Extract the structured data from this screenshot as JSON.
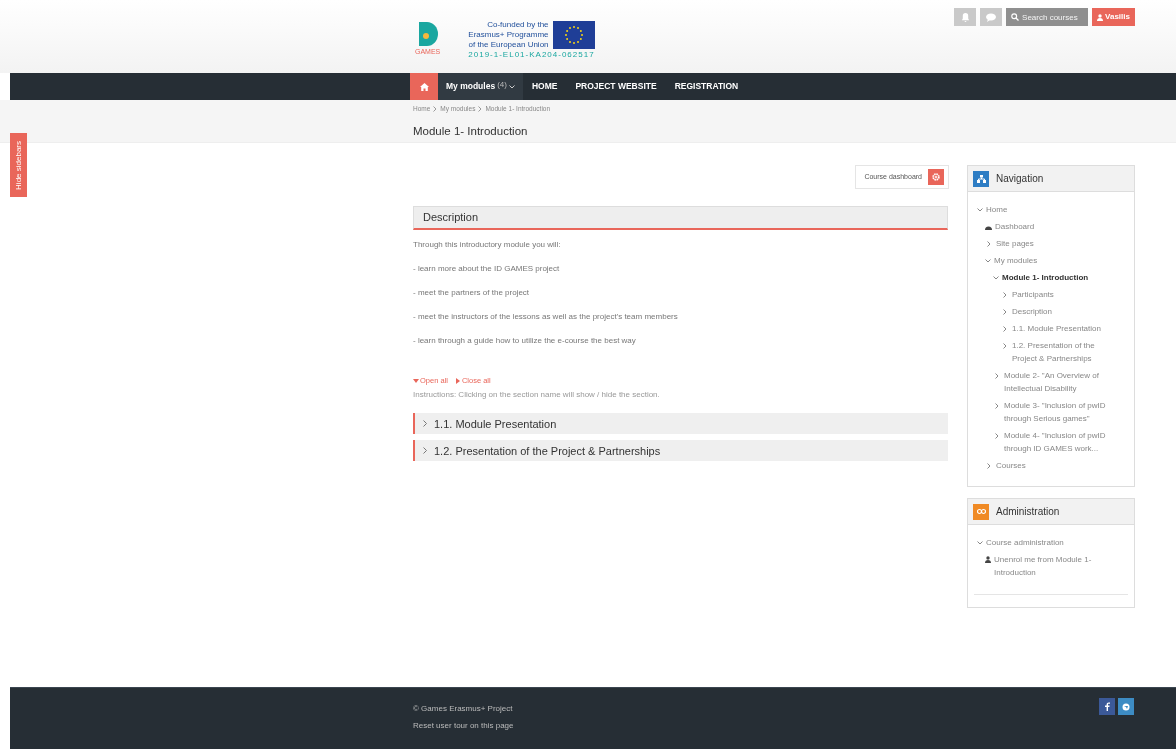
{
  "header": {
    "logo_text": "GAMES",
    "funding_lines": [
      "Co-funded by the",
      "Erasmus+ Programme",
      "of the European Union"
    ],
    "project_code": "2019-1-EL01-KA204-062517",
    "search": {
      "placeholder": "Search courses"
    },
    "user": "Vasilis"
  },
  "nav": {
    "items": [
      {
        "kind": "home",
        "selected": true
      },
      {
        "kind": "dropdown",
        "label": "My modules",
        "count": "(4)",
        "selected": false
      },
      {
        "kind": "link",
        "label": "HOME",
        "selected": false
      },
      {
        "kind": "link",
        "label": "PROJECT WEBSITE",
        "selected": false
      },
      {
        "kind": "link",
        "label": "REGISTRATION",
        "selected": false
      }
    ]
  },
  "breadcrumb": [
    "Home",
    "My modules",
    "Module 1- Introduction"
  ],
  "page_title": "Module 1- Introduction",
  "sidebar_toggle": "Hide sidebars",
  "course_dashboard": "Course dashboard",
  "description": {
    "title": "Description",
    "paragraphs": [
      "Through this introductory module you will:",
      "- learn more about the ID GAMES project",
      "- meet the partners of the project",
      "- meet the instructors of the lessons as well as the project's team members",
      "- learn through a guide how to utilize the e-course the best way"
    ]
  },
  "open_all": "Open all",
  "close_all": "Close all",
  "instructions": "Instructions: Clicking on the section name will show / hide the section.",
  "sections": [
    {
      "title": "1.1. Module Presentation",
      "expanded": false
    },
    {
      "title": "1.2. Presentation of the Project & Partnerships",
      "expanded": false
    }
  ],
  "navigation": {
    "title": "Navigation",
    "tree": [
      {
        "label": "Home",
        "kind": "node",
        "expanded": true,
        "current": false,
        "children": [
          {
            "label": "Dashboard",
            "kind": "dashboard",
            "current": false
          },
          {
            "label": "Site pages",
            "kind": "node",
            "expanded": false,
            "current": false
          },
          {
            "label": "My modules",
            "kind": "node",
            "expanded": true,
            "current": false,
            "children": [
              {
                "label": "Module 1- Introduction",
                "kind": "node",
                "expanded": true,
                "current": true,
                "children": [
                  {
                    "label": "Participants",
                    "kind": "node",
                    "expanded": false,
                    "current": false
                  },
                  {
                    "label": "Description",
                    "kind": "node",
                    "expanded": false,
                    "current": false
                  },
                  {
                    "label": "1.1. Module Presentation",
                    "kind": "node",
                    "expanded": false,
                    "current": false
                  },
                  {
                    "label": "1.2. Presentation of the Project & Partnerships",
                    "kind": "node",
                    "expanded": false,
                    "current": false
                  }
                ]
              },
              {
                "label": "Module 2- \"An Overview of Intellectual Disability",
                "kind": "node",
                "expanded": false,
                "current": false
              },
              {
                "label": "Module 3- \"Inclusion of pwID through Serious games\"",
                "kind": "node",
                "expanded": false,
                "current": false
              },
              {
                "label": "Module 4- \"Inclusion of pwID through ID GAMES work...",
                "kind": "node",
                "expanded": false,
                "current": false
              }
            ]
          },
          {
            "label": "Courses",
            "kind": "node",
            "expanded": false,
            "current": false
          }
        ]
      }
    ]
  },
  "administration": {
    "title": "Administration",
    "tree": [
      {
        "label": "Course administration",
        "kind": "node",
        "expanded": true,
        "current": false,
        "children": [
          {
            "label": "Unenrol me from Module 1- Introduction",
            "kind": "user",
            "current": false
          }
        ]
      }
    ]
  },
  "footer": {
    "copyright": "© Games Erasmus+ Project",
    "tour_link": "Reset user tour on this page"
  }
}
